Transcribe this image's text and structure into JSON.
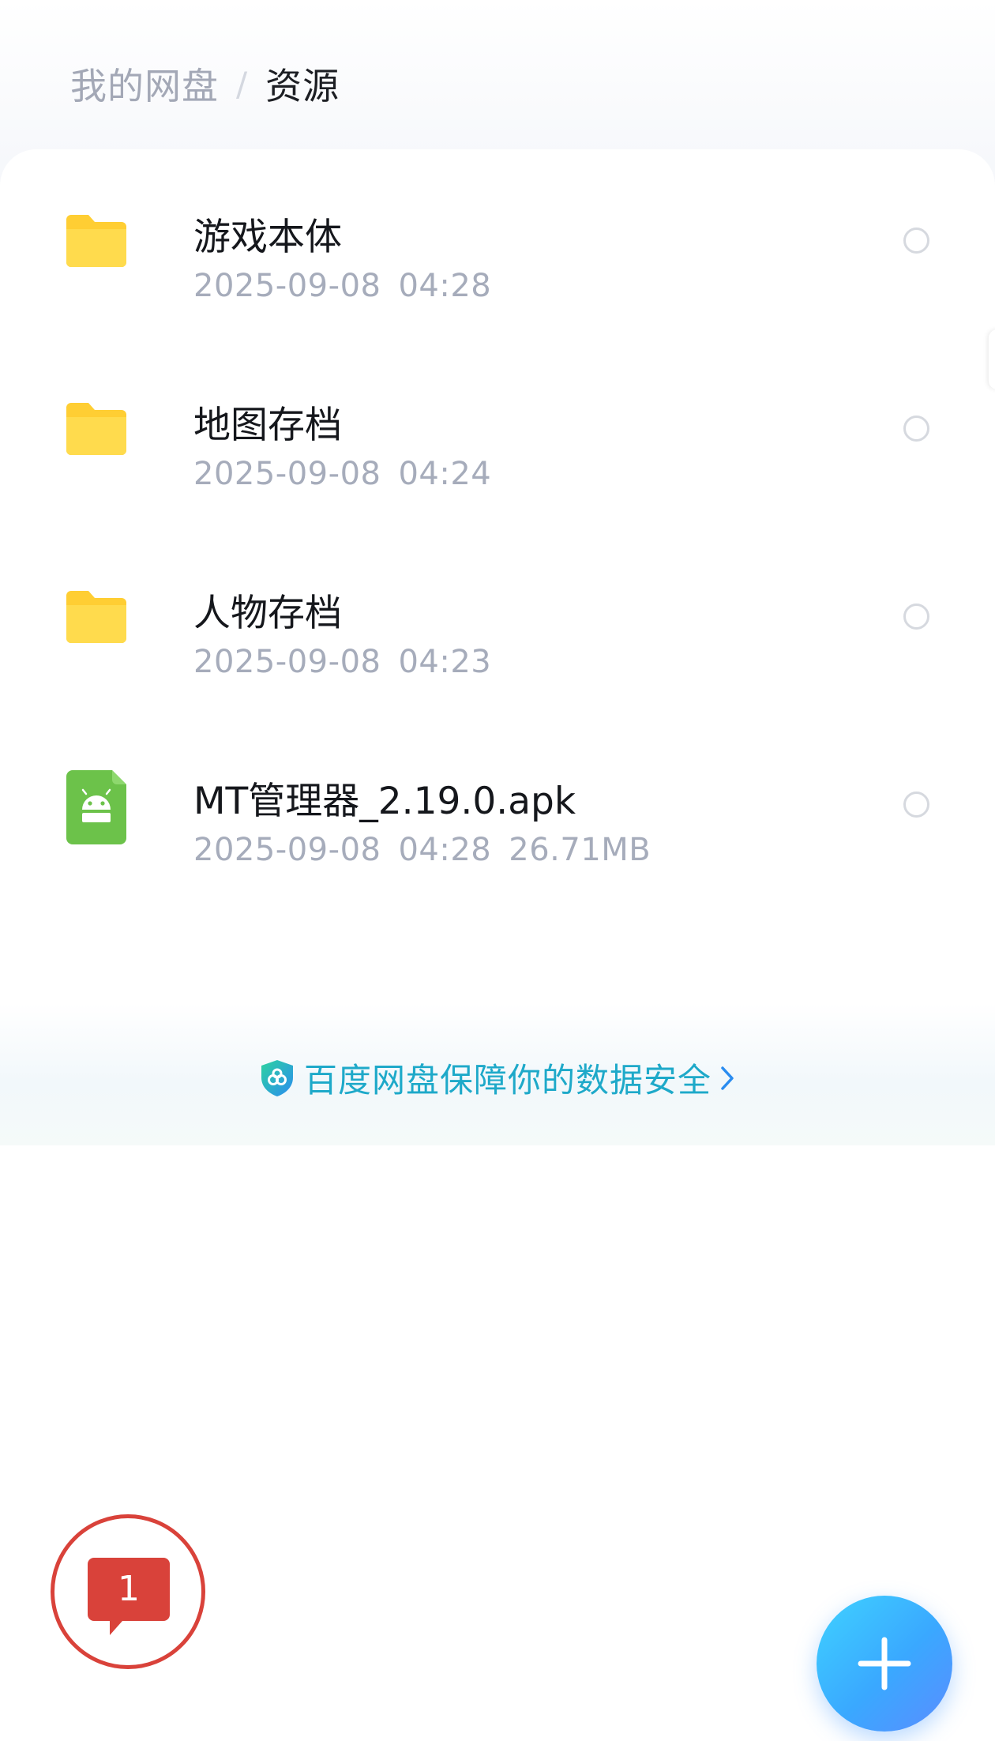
{
  "breadcrumb": {
    "root": "我的网盘",
    "separator": "/",
    "current": "资源"
  },
  "files": [
    {
      "name": "游戏本体",
      "date": "2025-09-08",
      "time": "04:28",
      "size": "",
      "icon": "folder-icon"
    },
    {
      "name": "地图存档",
      "date": "2025-09-08",
      "time": "04:24",
      "size": "",
      "icon": "folder-icon"
    },
    {
      "name": "人物存档",
      "date": "2025-09-08",
      "time": "04:23",
      "size": "",
      "icon": "folder-icon"
    },
    {
      "name": "MT管理器_2.19.0.apk",
      "date": "2025-09-08",
      "time": "04:28",
      "size": "26.71MB",
      "icon": "android-apk-icon"
    }
  ],
  "security_banner": {
    "text": "百度网盘保障你的数据安全",
    "icon": "shield-icon"
  },
  "message": {
    "count": "1"
  },
  "colors": {
    "folder": "#ffd23f",
    "apk": "#6cc24a",
    "accent": "#1ea9c9",
    "badge": "#d9423a",
    "fab": "#3aa8ff"
  }
}
